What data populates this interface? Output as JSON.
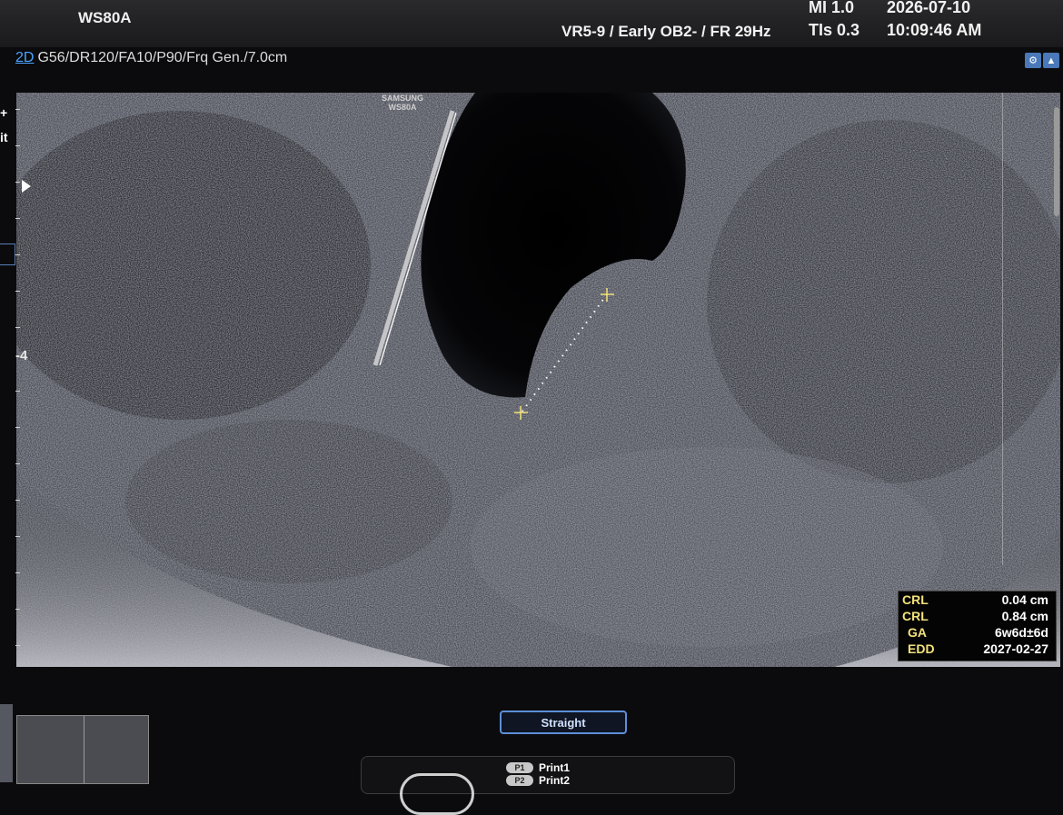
{
  "header": {
    "model": "WS80A",
    "preset": "VR5-9 / Early OB2- / FR 29Hz",
    "mi": "MI  1.0",
    "tis": "TIs 0.3",
    "date": "2026-07-10",
    "time": "10:09:46 AM"
  },
  "params": {
    "mode": "2D",
    "settings": "G56/DR120/FA10/P90/Frq Gen./7.0cm"
  },
  "image": {
    "brand_line1": "SAMSUNG",
    "brand_line2": "WS80A",
    "depth_label": "-4",
    "left_text1": "+",
    "left_text2": "it"
  },
  "measurements": [
    {
      "label": "CRL",
      "value": "0.04 cm"
    },
    {
      "label": "CRL",
      "value": "0.84 cm"
    },
    {
      "label": "GA",
      "value": "6w6d±6d"
    },
    {
      "label": "EDD",
      "value": "2027-02-27"
    }
  ],
  "controls": {
    "straight_label": "Straight",
    "print1_key": "P1",
    "print1_label": "Print1",
    "print2_key": "P2",
    "print2_label": "Print2"
  },
  "colors": {
    "measure_label": "#f3e27a",
    "accent_blue": "#4aa3ff"
  },
  "icons": [
    "settings-icon",
    "view-icon",
    "focus-arrow-icon"
  ]
}
